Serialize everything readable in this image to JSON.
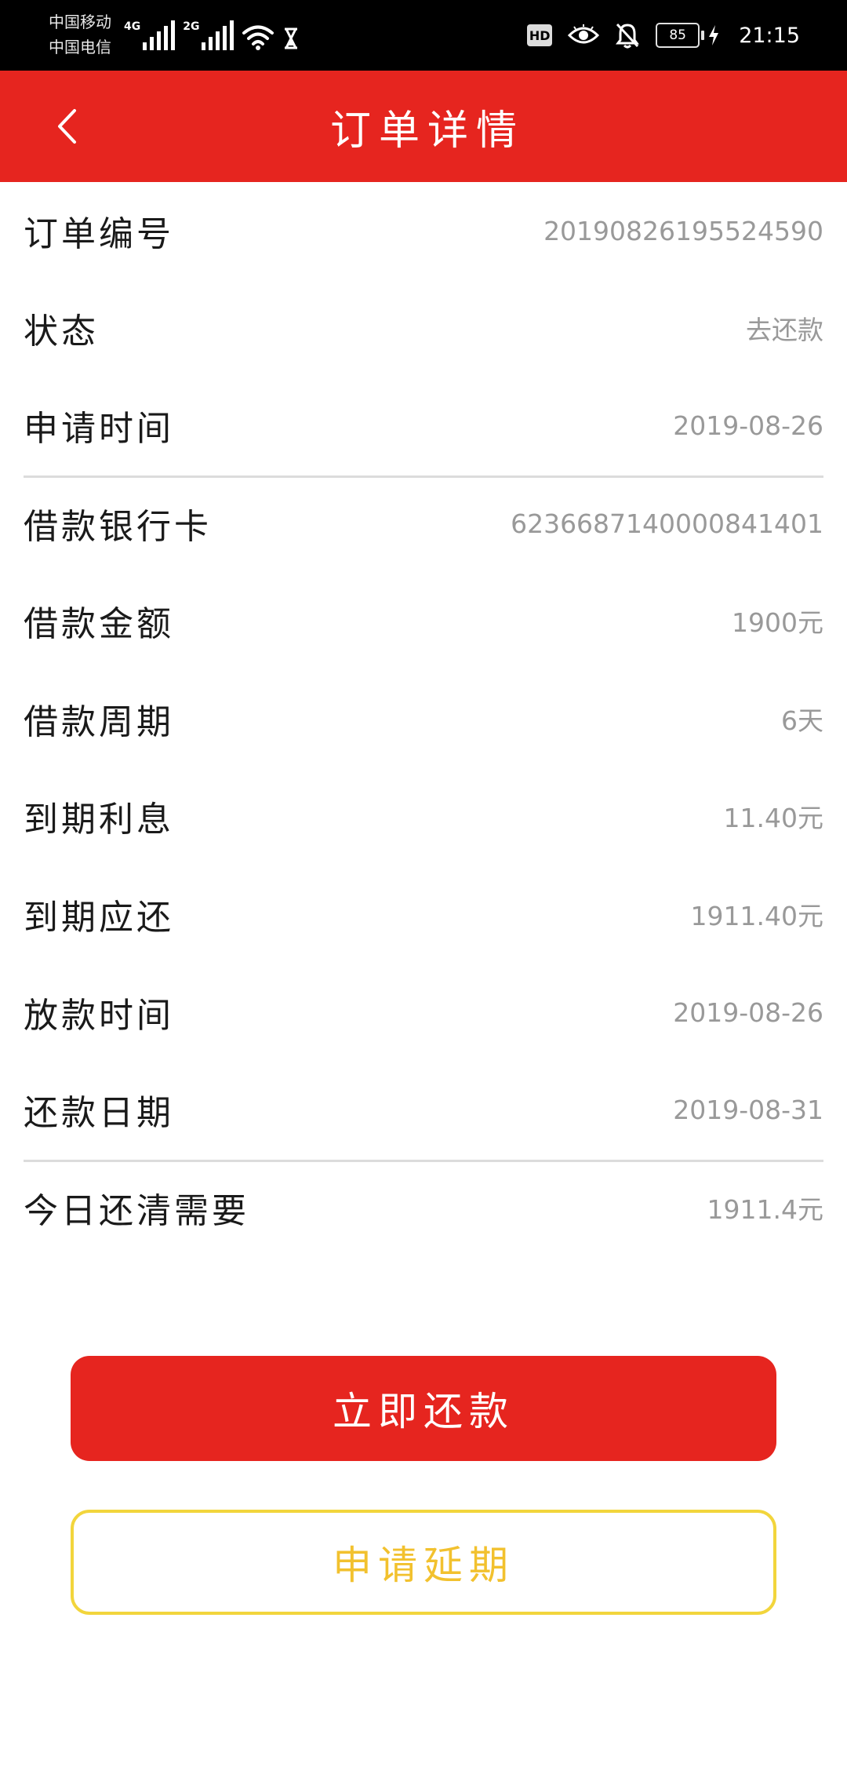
{
  "status_bar": {
    "carrier_1": "中国移动",
    "carrier_2": "中国电信",
    "network_1": "4G",
    "network_2": "2G",
    "hd": "HD",
    "battery": "85",
    "time": "21:15"
  },
  "header": {
    "title": "订单详情"
  },
  "details": [
    {
      "label": "订单编号",
      "value": "20190826195524590"
    },
    {
      "label": "状态",
      "value": "去还款"
    },
    {
      "label": "申请时间",
      "value": "2019-08-26"
    },
    {
      "label": "借款银行卡",
      "value": "6236687140000841401"
    },
    {
      "label": "借款金额",
      "value": "1900元"
    },
    {
      "label": "借款周期",
      "value": "6天"
    },
    {
      "label": "到期利息",
      "value": "11.40元"
    },
    {
      "label": "到期应还",
      "value": "1911.40元"
    },
    {
      "label": "放款时间",
      "value": "2019-08-26"
    },
    {
      "label": "还款日期",
      "value": "2019-08-31"
    },
    {
      "label": "今日还清需要",
      "value": "1911.4元"
    }
  ],
  "actions": {
    "repay_label": "立即还款",
    "extend_label": "申请延期"
  },
  "colors": {
    "brand_red": "#e6251f",
    "accent_yellow": "#f2d53c",
    "value_gray": "#999999"
  }
}
